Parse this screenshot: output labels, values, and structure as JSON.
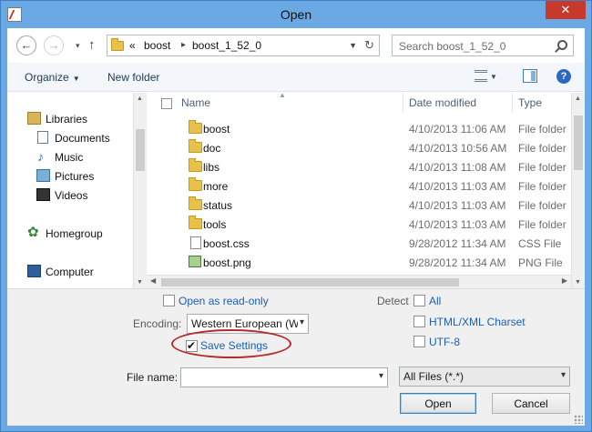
{
  "window": {
    "title": "Open",
    "close_glyph": "✕"
  },
  "address": {
    "history_glyph": "«",
    "parts": [
      "boost",
      "boost_1_52_0"
    ],
    "sep": "▸"
  },
  "search": {
    "placeholder": "Search boost_1_52_0"
  },
  "toolbar": {
    "organize": "Organize",
    "new_folder": "New folder"
  },
  "nav": {
    "libraries": "Libraries",
    "documents": "Documents",
    "music": "Music",
    "pictures": "Pictures",
    "videos": "Videos",
    "homegroup": "Homegroup",
    "computer": "Computer"
  },
  "columns": {
    "name": "Name",
    "date": "Date modified",
    "type": "Type"
  },
  "files": [
    {
      "name": "boost",
      "date": "4/10/2013 11:06 AM",
      "type": "File folder",
      "icon": "folder-icon"
    },
    {
      "name": "doc",
      "date": "4/10/2013 10:56 AM",
      "type": "File folder",
      "icon": "folder-icon"
    },
    {
      "name": "libs",
      "date": "4/10/2013 11:08 AM",
      "type": "File folder",
      "icon": "folder-icon"
    },
    {
      "name": "more",
      "date": "4/10/2013 11:03 AM",
      "type": "File folder",
      "icon": "folder-icon"
    },
    {
      "name": "status",
      "date": "4/10/2013 11:03 AM",
      "type": "File folder",
      "icon": "folder-icon"
    },
    {
      "name": "tools",
      "date": "4/10/2013 11:03 AM",
      "type": "File folder",
      "icon": "folder-icon"
    },
    {
      "name": "boost.css",
      "date": "9/28/2012 11:34 AM",
      "type": "CSS File",
      "icon": "css-file-icon"
    },
    {
      "name": "boost.png",
      "date": "9/28/2012 11:34 AM",
      "type": "PNG File",
      "icon": "png-file-icon"
    }
  ],
  "options": {
    "open_readonly": "Open as read-only",
    "detect": "Detect",
    "all": "All",
    "encoding_label": "Encoding:",
    "encoding_value": "Western European (W",
    "html_xml_charset": "HTML/XML Charset",
    "utf8": "UTF-8",
    "save_settings": "Save Settings",
    "save_settings_checked": true
  },
  "filename": {
    "label": "File name:",
    "value": ""
  },
  "filetype": {
    "value": "All Files (*.*)"
  },
  "buttons": {
    "open": "Open",
    "cancel": "Cancel"
  },
  "colors": {
    "title_bar": "#6aa9e3",
    "close": "#c7392d",
    "link": "#1a5fb4",
    "highlight": "#b52a2a"
  }
}
